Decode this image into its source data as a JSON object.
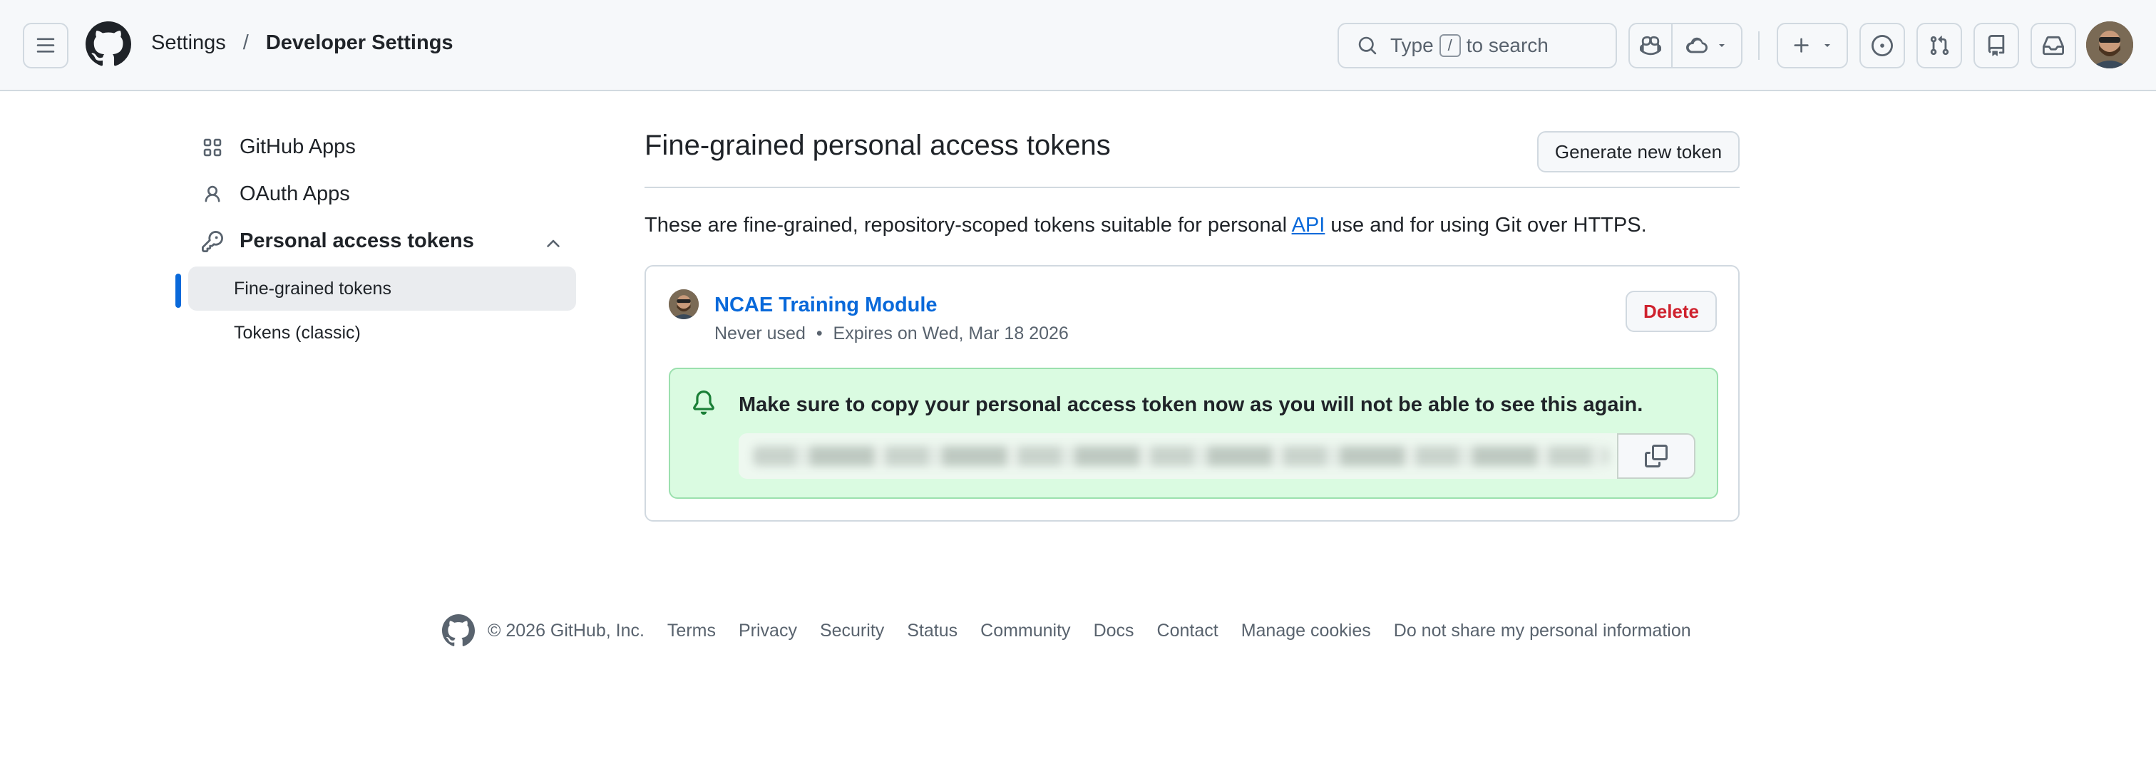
{
  "header": {
    "breadcrumb_root": "Settings",
    "breadcrumb_sep": "/",
    "breadcrumb_current": "Developer Settings",
    "search": {
      "prefix": "Type",
      "key": "/",
      "suffix": "to search"
    },
    "icons": [
      "hamburger-icon",
      "github-logo-icon",
      "search-icon",
      "copilot-icon",
      "cloud-icon",
      "plus-icon",
      "issues-icon",
      "pull-requests-icon",
      "repo-icon",
      "inbox-icon"
    ]
  },
  "sidebar": {
    "items": [
      {
        "label": "GitHub Apps",
        "icon": "apps-grid-icon"
      },
      {
        "label": "OAuth Apps",
        "icon": "person-icon"
      },
      {
        "label": "Personal access tokens",
        "icon": "key-icon"
      }
    ],
    "sub_items": [
      {
        "label": "Fine-grained tokens",
        "active": true
      },
      {
        "label": "Tokens (classic)",
        "active": false
      }
    ]
  },
  "main": {
    "title": "Fine-grained personal access tokens",
    "generate_label": "Generate new token",
    "description_before": "These are fine-grained, repository-scoped tokens suitable for personal ",
    "description_link": "API",
    "description_after": " use and for using Git over HTTPS.",
    "token": {
      "name": "NCAE Training Module",
      "usage": "Never used",
      "bullet": "•",
      "expiry": "Expires on Wed, Mar 18 2026",
      "delete_label": "Delete",
      "flash_message": "Make sure to copy your personal access token now as you will not be able to see this again."
    }
  },
  "footer": {
    "copyright": "© 2026 GitHub, Inc.",
    "links": [
      "Terms",
      "Privacy",
      "Security",
      "Status",
      "Community",
      "Docs",
      "Contact",
      "Manage cookies",
      "Do not share my personal information"
    ]
  },
  "colors": {
    "accent": "#0969da",
    "danger": "#cf222e",
    "success_bg": "#dafbe1"
  }
}
